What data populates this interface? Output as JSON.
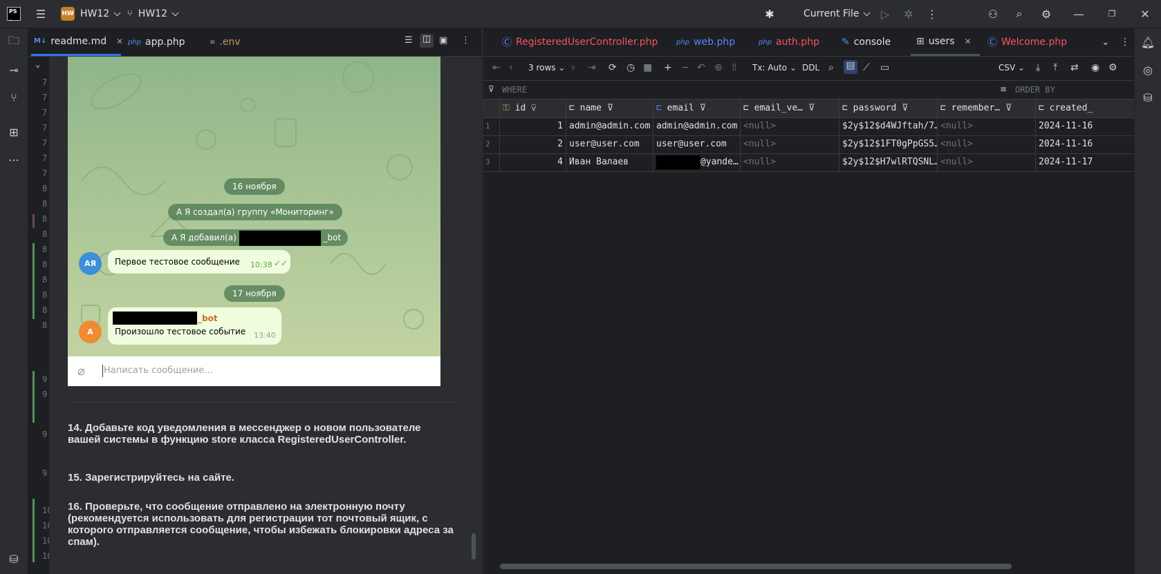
{
  "titlebar": {
    "project_badge": "HW",
    "project_name": "HW12",
    "branch": "HW12",
    "run_config": "Current File"
  },
  "editor": {
    "tabs": [
      {
        "label": "readme.md",
        "icon": "markdown-icon"
      },
      {
        "label": "app.php",
        "icon": "php-icon"
      },
      {
        "label": ".env",
        "icon": "text-file-icon"
      }
    ],
    "line_numbers": [
      "7",
      "7",
      "7",
      "7",
      "7",
      "7",
      "7",
      "8",
      "8",
      "8",
      "8",
      "8",
      "8",
      "8",
      "8",
      "8",
      "8",
      "9",
      "9",
      "9",
      "9",
      "10",
      "10",
      "10",
      "10"
    ]
  },
  "telegram": {
    "date1": "16 ноября",
    "system1": "А Я создал(а) группу «Мониторинг»",
    "system2_prefix": "А Я добавил(а)",
    "system2_suffix": "_bot",
    "avatar1": "АЯ",
    "msg1": "Первое тестовое сообщение",
    "msg1_time": "10:38",
    "date2": "17 ноября",
    "avatar2": "А",
    "msg2_sender_suffix": "_bot",
    "msg2": "Произошло тестовое событие",
    "msg2_time": "13:40",
    "input_placeholder": "Написать сообщение..."
  },
  "readme": {
    "step14": "14. Добавьте код уведомления в мессенджер о новом пользователе вашей системы в функцию store класса RegisteredUserController.",
    "step15": "15. Зарегистрируйтесь на сайте.",
    "step16": "16. Проверьте, что сообщение отправлено на электронную почту (рекомендуется использовать для регистрации тот почтовый ящик, с которого отправляется сообщение, чтобы избежать блокировки адреса за спам)."
  },
  "db": {
    "tabs": [
      {
        "label": "RegisteredUserController.php",
        "color": "#f75464"
      },
      {
        "label": "web.php",
        "color": "#548af7"
      },
      {
        "label": "auth.php",
        "color": "#f75464"
      },
      {
        "label": "console",
        "color": "#dfe1e5"
      },
      {
        "label": "users",
        "color": "#dfe1e5",
        "active": true
      },
      {
        "label": "Welcome.php",
        "color": "#f75464"
      }
    ],
    "toolbar": {
      "rows": "3 rows",
      "tx": "Tx: Auto",
      "ddl": "DDL",
      "export": "CSV"
    },
    "where": "WHERE",
    "order_by": "ORDER BY",
    "columns": [
      "id",
      "name",
      "email",
      "email_ve…",
      "password",
      "remember…",
      "created_"
    ],
    "rows": [
      {
        "n": "1",
        "id": "1",
        "name": "admin@admin.com",
        "email": "admin@admin.com",
        "email_verified": "<null>",
        "password": "$2y$12$d4WJftah/7…",
        "remember": "<null>",
        "created": "2024-11-16"
      },
      {
        "n": "2",
        "id": "2",
        "name": "user@user.com",
        "email": "user@user.com",
        "email_verified": "<null>",
        "password": "$2y$12$1FT0gPpGS5…",
        "remember": "<null>",
        "created": "2024-11-16"
      },
      {
        "n": "3",
        "id": "4",
        "name": "Иван Валаев",
        "email": "@yande…",
        "email_verified": "<null>",
        "password": "$2y$12$H7wlRTQSNL…",
        "remember": "<null>",
        "created": "2024-11-17"
      }
    ]
  }
}
